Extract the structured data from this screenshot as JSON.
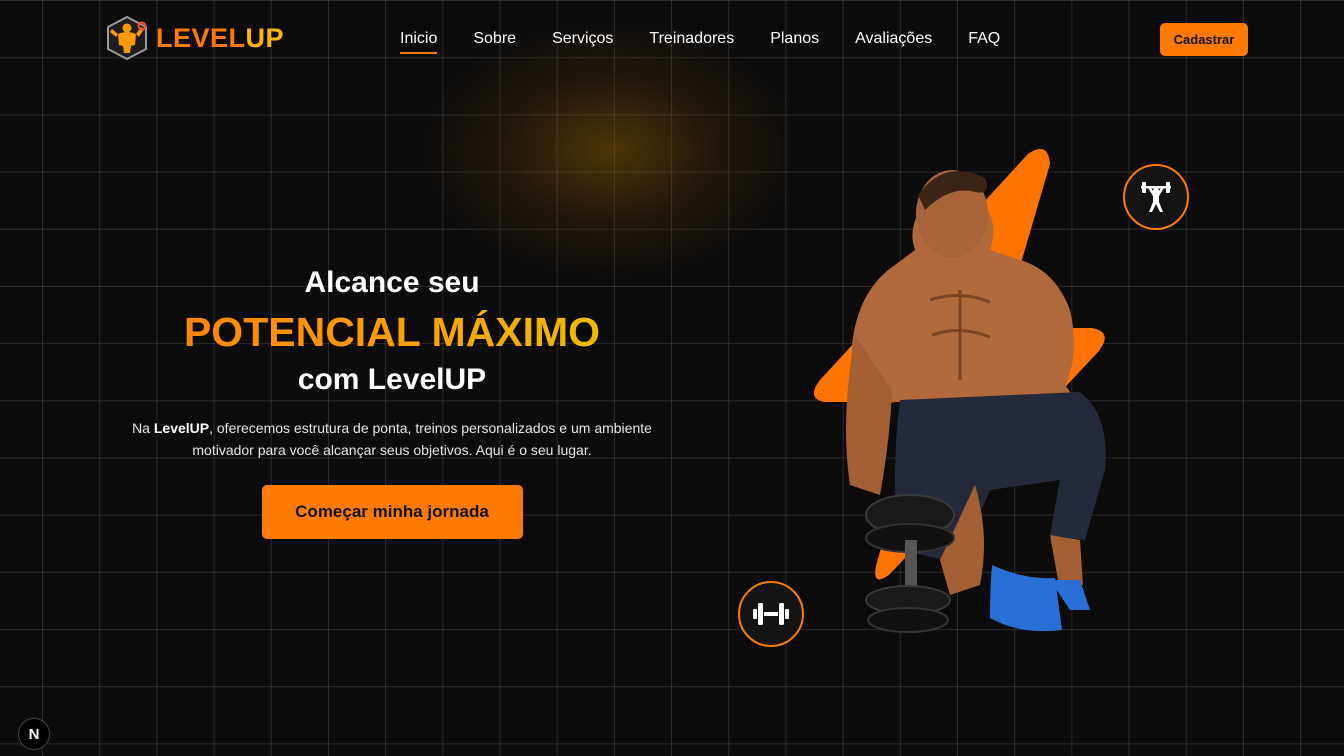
{
  "brand": {
    "name_part1": "LEVEL",
    "name_part2": "UP",
    "primary_color": "#ff7a00",
    "secondary_color": "#ffb400",
    "logo_icon": "bodybuilder-icon"
  },
  "nav": {
    "links": [
      {
        "label": "Inicio",
        "active": true
      },
      {
        "label": "Sobre",
        "active": false
      },
      {
        "label": "Serviços",
        "active": false
      },
      {
        "label": "Treinadores",
        "active": false
      },
      {
        "label": "Planos",
        "active": false
      },
      {
        "label": "Avaliações",
        "active": false
      },
      {
        "label": "FAQ",
        "active": false
      }
    ],
    "signup_label": "Cadastrar"
  },
  "hero": {
    "line1": "Alcance seu",
    "line2": "POTENCIAL MÁXIMO",
    "line3": "com LevelUP",
    "desc_prefix": "Na ",
    "desc_brand": "LevelUP",
    "desc_rest": ", oferecemos estrutura de ponta, treinos personalizados e um ambiente motivador para você alcançar seus objetivos. Aqui é o seu lugar.",
    "cta_label": "Começar minha jornada"
  },
  "badges": {
    "top_icon": "weightlifter-icon",
    "bottom_icon": "dumbbell-icon"
  },
  "dev_badge": {
    "label": "N"
  }
}
